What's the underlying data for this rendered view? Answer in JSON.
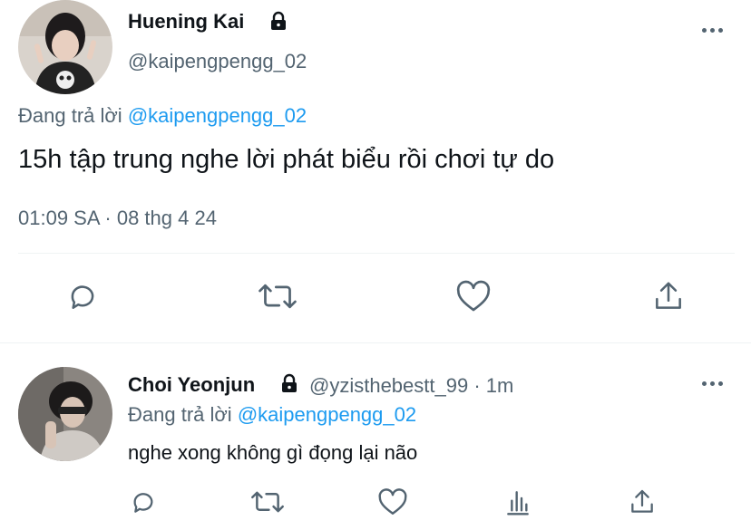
{
  "tweet": {
    "author_name": "Huening Kai",
    "handle": "@kaipengpengg_02",
    "reply_prefix": "Đang trả lời",
    "reply_to": "@kaipengpengg_02",
    "text": "15h tập trung nghe lời phát biểu rồi chơi tự do",
    "timestamp": "01:09 SA · 08 thg 4 24"
  },
  "reply": {
    "author_name": "Choi Yeonjun",
    "handle": "@yzisthebestt_99",
    "time": " · 1m",
    "reply_prefix": "Đang trả lời",
    "reply_to": "@kaipengpengg_02",
    "text": "nghe xong không gì đọng lại não"
  },
  "icons": {
    "main_actions": [
      "comment-icon",
      "retweet-icon",
      "heart-icon",
      "share-icon"
    ],
    "reply_actions": [
      "comment-icon",
      "retweet-icon",
      "heart-icon",
      "analytics-icon",
      "share-icon"
    ],
    "lock": "lock-icon",
    "more": "more-icon"
  },
  "colors": {
    "link": "#1d9bf0",
    "secondary": "#536471",
    "text": "#0f1419",
    "divider": "#eff3f4"
  }
}
